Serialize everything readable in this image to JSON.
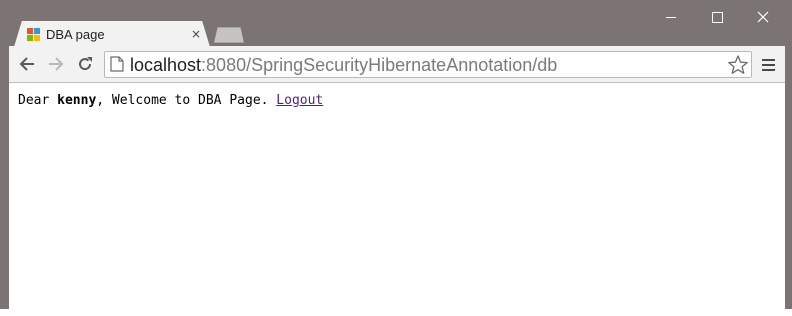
{
  "window": {
    "frame_color": "#7b7472",
    "controls": {
      "minimize_icon": "minimize-icon",
      "maximize_icon": "maximize-icon",
      "close_icon": "close-icon"
    }
  },
  "tabs": [
    {
      "title": "DBA page",
      "favicon": "spring-favicon",
      "close_glyph": "×",
      "active": true
    }
  ],
  "toolbar": {
    "back_icon": "back-arrow-icon",
    "forward_icon": "forward-arrow-icon",
    "reload_icon": "reload-icon",
    "bookmark_icon": "star-icon",
    "menu_icon": "hamburger-menu-icon"
  },
  "address_bar": {
    "host": "localhost",
    "rest": ":8080/SpringSecurityHibernateAnnotation/db",
    "page_icon": "page-icon"
  },
  "page": {
    "greeting_prefix": "Dear ",
    "username": "kenny",
    "greeting_suffix": ", Welcome to DBA Page. ",
    "logout_link": "Logout",
    "link_color": "#551a8b"
  }
}
